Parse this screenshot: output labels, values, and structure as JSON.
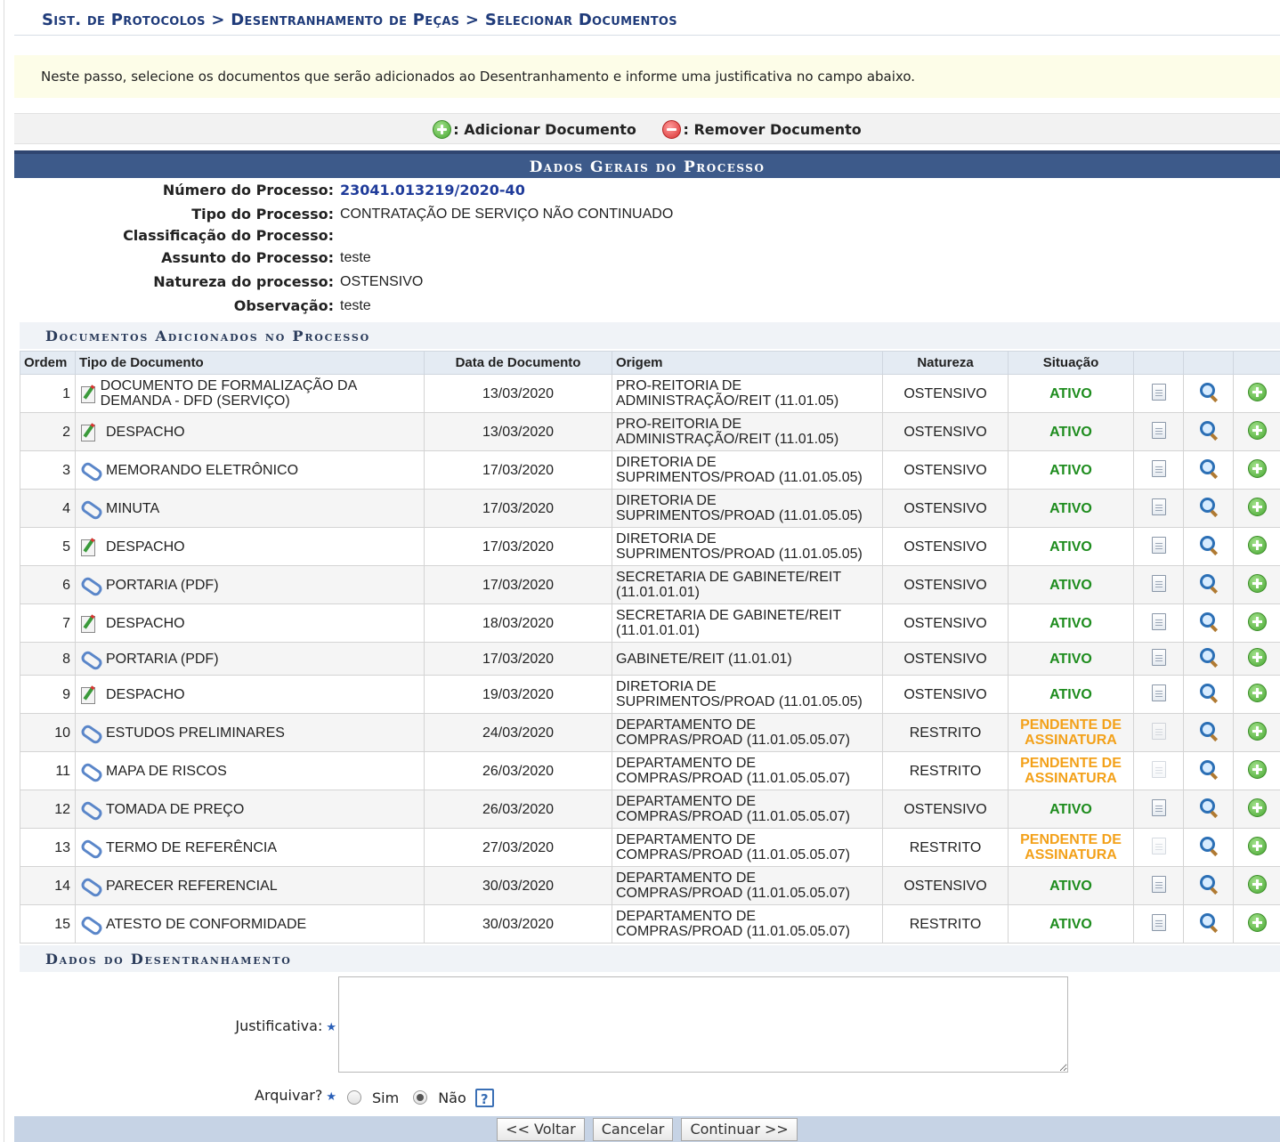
{
  "breadcrumb": "Sist. de Protocolos > Desentranhamento de Peças > Selecionar Documentos",
  "intro": "Neste passo, selecione os documentos que serão adicionados ao Desentranhamento e informe uma justificativa no campo abaixo.",
  "legend": {
    "add_label": ": Adicionar Documento",
    "remove_label": ": Remover Documento"
  },
  "section_title": "Dados Gerais do Processo",
  "process": {
    "numero_label": "Número do Processo:",
    "numero": "23041.013219/2020-40",
    "tipo_label": "Tipo do Processo:",
    "tipo": "CONTRATAÇÃO DE SERVIÇO NÃO CONTINUADO",
    "classificacao_label": "Classificação do Processo:",
    "classificacao": "",
    "assunto_label": "Assunto do Processo:",
    "assunto": "teste",
    "natureza_label": "Natureza do processo:",
    "natureza": "OSTENSIVO",
    "observacao_label": "Observação:",
    "observacao": "teste"
  },
  "docs_title": "Documentos Adicionados no Processo",
  "columns": {
    "ordem": "Ordem",
    "tipo": "Tipo de Documento",
    "data": "Data de Documento",
    "origem": "Origem",
    "natureza": "Natureza",
    "situacao": "Situação"
  },
  "documents": [
    {
      "ordem": "1",
      "icon": "despacho-icon",
      "tipo": "DOCUMENTO DE FORMALIZAÇÃO DA DEMANDA - DFD (SERVIÇO)",
      "data": "13/03/2020",
      "origem": "PRO-REITORIA DE ADMINISTRAÇÃO/REIT (11.01.05)",
      "natureza": "OSTENSIVO",
      "situacao": "ATIVO",
      "status": "ativo"
    },
    {
      "ordem": "2",
      "icon": "despacho-icon",
      "tipo": "DESPACHO",
      "data": "13/03/2020",
      "origem": "PRO-REITORIA DE ADMINISTRAÇÃO/REIT (11.01.05)",
      "natureza": "OSTENSIVO",
      "situacao": "ATIVO",
      "status": "ativo"
    },
    {
      "ordem": "3",
      "icon": "paperclip-icon",
      "tipo": "MEMORANDO ELETRÔNICO",
      "data": "17/03/2020",
      "origem": "DIRETORIA DE SUPRIMENTOS/PROAD (11.01.05.05)",
      "natureza": "OSTENSIVO",
      "situacao": "ATIVO",
      "status": "ativo"
    },
    {
      "ordem": "4",
      "icon": "paperclip-icon",
      "tipo": "MINUTA",
      "data": "17/03/2020",
      "origem": "DIRETORIA DE SUPRIMENTOS/PROAD (11.01.05.05)",
      "natureza": "OSTENSIVO",
      "situacao": "ATIVO",
      "status": "ativo"
    },
    {
      "ordem": "5",
      "icon": "despacho-icon",
      "tipo": "DESPACHO",
      "data": "17/03/2020",
      "origem": "DIRETORIA DE SUPRIMENTOS/PROAD (11.01.05.05)",
      "natureza": "OSTENSIVO",
      "situacao": "ATIVO",
      "status": "ativo"
    },
    {
      "ordem": "6",
      "icon": "paperclip-icon",
      "tipo": "PORTARIA (PDF)",
      "data": "17/03/2020",
      "origem": "SECRETARIA DE GABINETE/REIT (11.01.01.01)",
      "natureza": "OSTENSIVO",
      "situacao": "ATIVO",
      "status": "ativo"
    },
    {
      "ordem": "7",
      "icon": "despacho-icon",
      "tipo": "DESPACHO",
      "data": "18/03/2020",
      "origem": "SECRETARIA DE GABINETE/REIT (11.01.01.01)",
      "natureza": "OSTENSIVO",
      "situacao": "ATIVO",
      "status": "ativo"
    },
    {
      "ordem": "8",
      "icon": "paperclip-icon",
      "tipo": "PORTARIA (PDF)",
      "data": "17/03/2020",
      "origem": "GABINETE/REIT (11.01.01)",
      "natureza": "OSTENSIVO",
      "situacao": "ATIVO",
      "status": "ativo",
      "short": true
    },
    {
      "ordem": "9",
      "icon": "despacho-icon",
      "tipo": "DESPACHO",
      "data": "19/03/2020",
      "origem": "DIRETORIA DE SUPRIMENTOS/PROAD (11.01.05.05)",
      "natureza": "OSTENSIVO",
      "situacao": "ATIVO",
      "status": "ativo"
    },
    {
      "ordem": "10",
      "icon": "paperclip-icon",
      "tipo": "ESTUDOS PRELIMINARES",
      "data": "24/03/2020",
      "origem": "DEPARTAMENTO DE COMPRAS/PROAD (11.01.05.05.07)",
      "natureza": "RESTRITO",
      "situacao": "PENDENTE DE ASSINATURA",
      "status": "pendente"
    },
    {
      "ordem": "11",
      "icon": "paperclip-icon",
      "tipo": "MAPA DE RISCOS",
      "data": "26/03/2020",
      "origem": "DEPARTAMENTO DE COMPRAS/PROAD (11.01.05.05.07)",
      "natureza": "RESTRITO",
      "situacao": "PENDENTE DE ASSINATURA",
      "status": "pendente"
    },
    {
      "ordem": "12",
      "icon": "paperclip-icon",
      "tipo": "TOMADA DE PREÇO",
      "data": "26/03/2020",
      "origem": "DEPARTAMENTO DE COMPRAS/PROAD (11.01.05.05.07)",
      "natureza": "OSTENSIVO",
      "situacao": "ATIVO",
      "status": "ativo"
    },
    {
      "ordem": "13",
      "icon": "paperclip-icon",
      "tipo": "TERMO DE REFERÊNCIA",
      "data": "27/03/2020",
      "origem": "DEPARTAMENTO DE COMPRAS/PROAD (11.01.05.05.07)",
      "natureza": "RESTRITO",
      "situacao": "PENDENTE DE ASSINATURA",
      "status": "pendente"
    },
    {
      "ordem": "14",
      "icon": "paperclip-icon",
      "tipo": "PARECER REFERENCIAL",
      "data": "30/03/2020",
      "origem": "DEPARTAMENTO DE COMPRAS/PROAD (11.01.05.05.07)",
      "natureza": "OSTENSIVO",
      "situacao": "ATIVO",
      "status": "ativo"
    },
    {
      "ordem": "15",
      "icon": "paperclip-icon",
      "tipo": "ATESTO DE CONFORMIDADE",
      "data": "30/03/2020",
      "origem": "DEPARTAMENTO DE COMPRAS/PROAD (11.01.05.05.07)",
      "natureza": "RESTRITO",
      "situacao": "ATIVO",
      "status": "ativo"
    }
  ],
  "desentranhamento_title": "Dados do Desentranhamento",
  "form": {
    "justificativa_label": "Justificativa:",
    "justificativa_value": "",
    "arquivar_label": "Arquivar?",
    "sim_label": "Sim",
    "nao_label": "Não",
    "selected": "nao",
    "help_glyph": "?"
  },
  "buttons": {
    "voltar": "<< Voltar",
    "cancelar": "Cancelar",
    "continuar": "Continuar >>"
  },
  "colors": {
    "header_bg": "#3d5a8a",
    "breadcrumb": "#1f3b7a",
    "ativo": "#1d8c1d",
    "pendente": "#f3a11a",
    "intro_bg": "#fdfde8"
  }
}
